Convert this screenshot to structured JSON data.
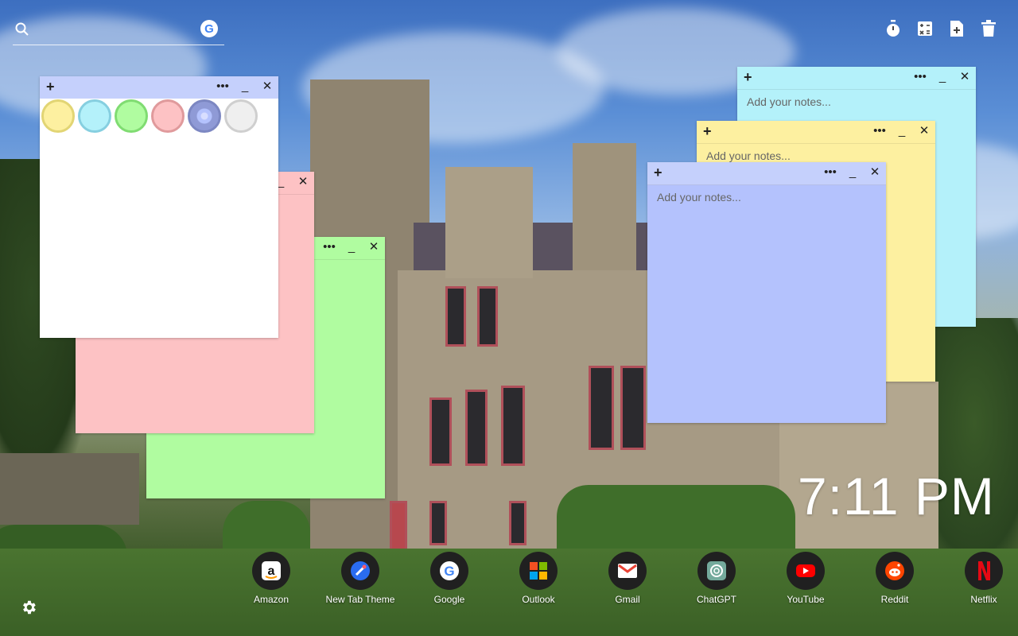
{
  "search": {
    "placeholder": "",
    "icon": "search-icon",
    "engine_icon": "google-icon",
    "engine_letter": "G"
  },
  "tools": [
    {
      "name": "timer-icon"
    },
    {
      "name": "calculator-icon"
    },
    {
      "name": "add-note-icon"
    },
    {
      "name": "trash-icon"
    }
  ],
  "notes": {
    "note_controls": {
      "add": "+",
      "menu": "•••",
      "minimize": "_",
      "close": "✕"
    },
    "placeholder": "Add your notes...",
    "colors": {
      "yellow": "#fdf0a0",
      "cyan": "#b4f1fa",
      "green": "#b0fca0",
      "pink": "#fdc2c4",
      "blue": "#b4c2fd",
      "white": "#ffffff",
      "header_blue": "#c5d0fc"
    },
    "palette": [
      "yellow",
      "cyan",
      "green",
      "pink",
      "blue",
      "white"
    ]
  },
  "clock": {
    "time": "7:11 PM"
  },
  "dock": [
    {
      "label": "Amazon",
      "icon": "amazon-icon"
    },
    {
      "label": "New Tab Theme",
      "icon": "new-tab-theme-icon"
    },
    {
      "label": "Google",
      "icon": "google-icon"
    },
    {
      "label": "Outlook",
      "icon": "outlook-icon"
    },
    {
      "label": "Gmail",
      "icon": "gmail-icon"
    },
    {
      "label": "ChatGPT",
      "icon": "chatgpt-icon"
    },
    {
      "label": "YouTube",
      "icon": "youtube-icon"
    },
    {
      "label": "Reddit",
      "icon": "reddit-icon"
    },
    {
      "label": "Netflix",
      "icon": "netflix-icon"
    }
  ],
  "settings": {
    "icon": "gear-icon"
  }
}
